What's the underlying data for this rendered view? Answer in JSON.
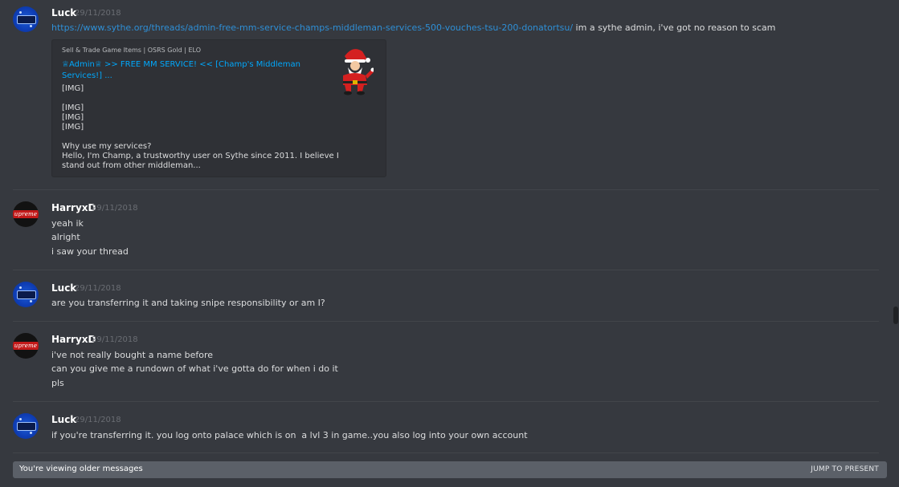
{
  "messages": [
    {
      "author": "Luck",
      "timestamp": "29/11/2018",
      "lines": [
        "https://www.sythe.org/threads/admin-free-mm-service-champs-middleman-services-500-vouches-tsu-200-donatortsu/",
        " im a sythe admin, i've got no reason to scam"
      ],
      "embed": {
        "provider": "Sell & Trade Game Items | OSRS Gold | ELO",
        "title": "♕Admin♕ >> FREE MM SERVICE! << [Champ's Middleman Services!] ...",
        "description": [
          "[IMG]",
          "[IMG]",
          "[IMG]",
          "[IMG]",
          "Why use my services?",
          "Hello, I'm Champ, a trustworthy user on Sythe since 2011. I believe I",
          "stand out from other middleman..."
        ]
      }
    },
    {
      "author": "HarryxD",
      "timestamp": "29/11/2018",
      "lines": [
        "yeah ik",
        "alright",
        "i saw your thread"
      ]
    },
    {
      "author": "Luck",
      "timestamp": "29/11/2018",
      "lines": [
        "are you transferring it and taking snipe responsibility or am I?"
      ]
    },
    {
      "author": "HarryxD",
      "timestamp": "29/11/2018",
      "lines": [
        "i've not really bought a name before",
        "can you give me a rundown of what i've gotta do for when i do it",
        "pls"
      ]
    },
    {
      "author": "Luck",
      "timestamp": "29/11/2018",
      "lines": [
        "if you're transferring it. you log onto palace which is on  a lvl 3 in game..you also log into your own account"
      ]
    }
  ],
  "avatar_text": {
    "harry": "upreme"
  },
  "footer": {
    "notice": "You're viewing older messages",
    "jump": "JUMP TO PRESENT"
  },
  "colors": {
    "background": "#36393f",
    "link": "#2e8fd6",
    "bar": "#5b6068"
  }
}
